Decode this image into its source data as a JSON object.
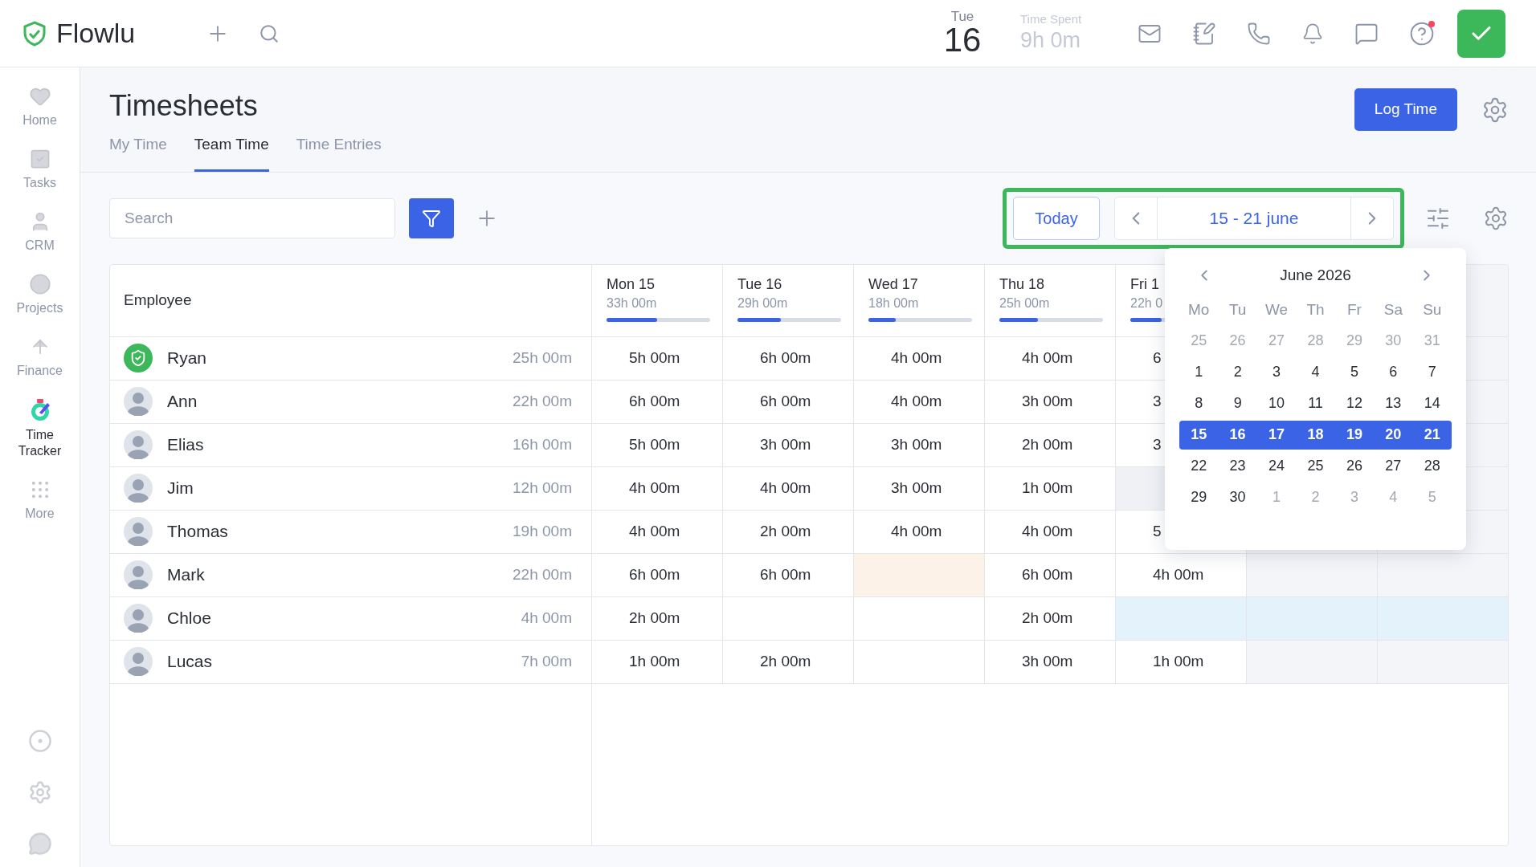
{
  "topbar": {
    "logo": "Flowlu",
    "date": {
      "weekday": "Tue",
      "day": "16"
    },
    "time_spent": {
      "label": "Time Spent",
      "value": "9h 0m"
    },
    "help_unread": true
  },
  "sidebar": {
    "items": [
      {
        "label": "Home",
        "selected": false
      },
      {
        "label": "Tasks",
        "selected": false
      },
      {
        "label": "CRM",
        "selected": false
      },
      {
        "label": "Projects",
        "selected": false
      },
      {
        "label": "Finance",
        "selected": false
      },
      {
        "label": "Time Tracker",
        "selected": true
      },
      {
        "label": "More",
        "selected": false
      }
    ]
  },
  "page": {
    "title": "Timesheets",
    "primary_button": "Log Time",
    "tabs": [
      {
        "label": "My Time",
        "selected": false
      },
      {
        "label": "Team Time",
        "selected": true
      },
      {
        "label": "Time Entries",
        "selected": false
      }
    ]
  },
  "toolbar": {
    "search": {
      "placeholder": "Search"
    },
    "today_button": "Today",
    "range": "15 - 21 june"
  },
  "table": {
    "employee_header": "Employee",
    "days": [
      {
        "label": "Mon 15",
        "total": "33h 00m",
        "level": 0.49
      },
      {
        "label": "Tue 16",
        "total": "29h 00m",
        "level": 0.42
      },
      {
        "label": "Wed 17",
        "total": "18h 00m",
        "level": 0.26
      },
      {
        "label": "Thu 18",
        "total": "25h 00m",
        "level": 0.37
      },
      {
        "label": "Fri 1",
        "total": "22h 0",
        "level": 0.3
      }
    ],
    "rows": [
      {
        "name": "Ryan",
        "kind": "team",
        "total": "25h 00m",
        "cells": [
          {
            "text": "5h 00m"
          },
          {
            "text": "6h 00m"
          },
          {
            "text": "4h 00m"
          },
          {
            "text": "4h 00m"
          },
          {
            "text": "6"
          }
        ]
      },
      {
        "name": "Ann",
        "kind": "person",
        "total": "22h 00m",
        "cells": [
          {
            "text": "6h 00m"
          },
          {
            "text": "6h 00m"
          },
          {
            "text": "4h 00m"
          },
          {
            "text": "3h 00m"
          },
          {
            "text": "3"
          }
        ]
      },
      {
        "name": "Elias",
        "kind": "person",
        "total": "16h 00m",
        "cells": [
          {
            "text": "5h 00m"
          },
          {
            "text": "3h 00m"
          },
          {
            "text": "3h 00m"
          },
          {
            "text": "2h 00m"
          },
          {
            "text": "3"
          }
        ]
      },
      {
        "name": "Jim",
        "kind": "person",
        "total": "12h 00m",
        "cells": [
          {
            "text": "4h 00m"
          },
          {
            "text": "4h 00m"
          },
          {
            "text": "3h 00m"
          },
          {
            "text": "1h 00m"
          },
          {
            "color": "#eff1f5"
          }
        ]
      },
      {
        "name": "Thomas",
        "kind": "person",
        "total": "19h 00m",
        "cells": [
          {
            "text": "4h 00m"
          },
          {
            "text": "2h 00m"
          },
          {
            "text": "4h 00m"
          },
          {
            "text": "4h 00m"
          },
          {
            "text": "5"
          }
        ]
      },
      {
        "name": "Mark",
        "kind": "person",
        "total": "22h 00m",
        "cells": [
          {
            "text": "6h 00m"
          },
          {
            "text": "6h 00m"
          },
          {
            "color": "#fdf2e8"
          },
          {
            "text": "6h 00m"
          },
          {
            "text": "4h 00m"
          }
        ]
      },
      {
        "name": "Chloe",
        "kind": "person",
        "total": "4h 00m",
        "cells": [
          {
            "text": "2h 00m"
          },
          {},
          {},
          {
            "text": "2h 00m"
          },
          {
            "color": "#e4f3fb"
          },
          {
            "color": "#e4f3fb"
          },
          {
            "color": "#e4f3fb"
          }
        ]
      },
      {
        "name": "Lucas",
        "kind": "person",
        "total": "7h 00m",
        "cells": [
          {
            "text": "1h 00m"
          },
          {
            "text": "2h 00m"
          },
          {},
          {
            "text": "3h 00m"
          },
          {
            "text": "1h 00m"
          }
        ]
      }
    ]
  },
  "calendar": {
    "title": "June 2026",
    "weekdays": [
      "Mo",
      "Tu",
      "We",
      "Th",
      "Fr",
      "Sa",
      "Su"
    ],
    "weeks": [
      {
        "selected": false,
        "days": [
          {
            "text": "25",
            "muted": true
          },
          {
            "text": "26",
            "muted": true
          },
          {
            "text": "27",
            "muted": true
          },
          {
            "text": "28",
            "muted": true
          },
          {
            "text": "29",
            "muted": true
          },
          {
            "text": "30",
            "muted": true
          },
          {
            "text": "31",
            "muted": true
          }
        ]
      },
      {
        "selected": false,
        "days": [
          {
            "text": "1",
            "muted": false
          },
          {
            "text": "2",
            "muted": false
          },
          {
            "text": "3",
            "muted": false
          },
          {
            "text": "4",
            "muted": false
          },
          {
            "text": "5",
            "muted": false
          },
          {
            "text": "6",
            "muted": false
          },
          {
            "text": "7",
            "muted": false
          }
        ]
      },
      {
        "selected": false,
        "days": [
          {
            "text": "8",
            "muted": false
          },
          {
            "text": "9",
            "muted": false
          },
          {
            "text": "10",
            "muted": false
          },
          {
            "text": "11",
            "muted": false
          },
          {
            "text": "12",
            "muted": false
          },
          {
            "text": "13",
            "muted": false
          },
          {
            "text": "14",
            "muted": false
          }
        ]
      },
      {
        "selected": true,
        "days": [
          {
            "text": "15",
            "muted": false
          },
          {
            "text": "16",
            "muted": false
          },
          {
            "text": "17",
            "muted": false
          },
          {
            "text": "18",
            "muted": false
          },
          {
            "text": "19",
            "muted": false
          },
          {
            "text": "20",
            "muted": false
          },
          {
            "text": "21",
            "muted": false
          }
        ]
      },
      {
        "selected": false,
        "days": [
          {
            "text": "22",
            "muted": false
          },
          {
            "text": "23",
            "muted": false
          },
          {
            "text": "24",
            "muted": false
          },
          {
            "text": "25",
            "muted": false
          },
          {
            "text": "26",
            "muted": false
          },
          {
            "text": "27",
            "muted": false
          },
          {
            "text": "28",
            "muted": false
          }
        ]
      },
      {
        "selected": false,
        "days": [
          {
            "text": "29",
            "muted": false
          },
          {
            "text": "30",
            "muted": false
          },
          {
            "text": "1",
            "muted": true
          },
          {
            "text": "2",
            "muted": true
          },
          {
            "text": "3",
            "muted": true
          },
          {
            "text": "4",
            "muted": true
          },
          {
            "text": "5",
            "muted": true
          }
        ]
      }
    ]
  }
}
